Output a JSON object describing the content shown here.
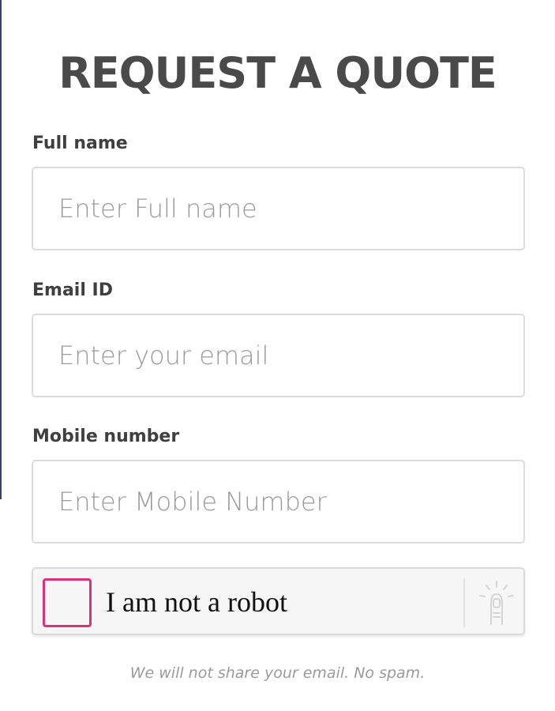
{
  "form": {
    "title": "REQUEST A QUOTE",
    "fields": [
      {
        "label": "Full name",
        "placeholder": "Enter Full name",
        "value": ""
      },
      {
        "label": "Email ID",
        "placeholder": "Enter your email",
        "value": ""
      },
      {
        "label": "Mobile number",
        "placeholder": "Enter Mobile Number",
        "value": ""
      }
    ],
    "captcha": {
      "label": "I am not a robot",
      "checked": false,
      "icon": "touch-finger-icon",
      "accent_color": "#e0307a"
    },
    "privacy_note": "We will not share your email. No spam."
  }
}
